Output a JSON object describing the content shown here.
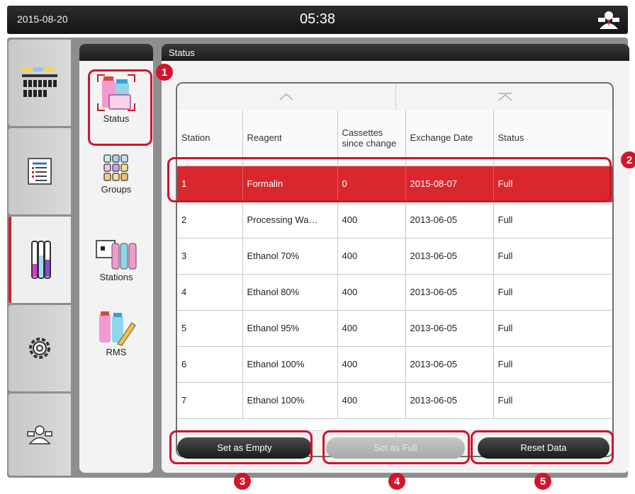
{
  "topbar": {
    "date": "2015-08-20",
    "time": "05:38"
  },
  "submenu": {
    "items": [
      {
        "label": "Status",
        "icon": "reagent-status-icon"
      },
      {
        "label": "Groups",
        "icon": "groups-icon"
      },
      {
        "label": "Stations",
        "icon": "stations-icon"
      },
      {
        "label": "RMS",
        "icon": "rms-icon"
      }
    ]
  },
  "panel": {
    "title": "Status",
    "columns": [
      "Station",
      "Reagent",
      "Cassettes since change",
      "Exchange Date",
      "Status"
    ],
    "rows": [
      [
        "1",
        "Formalin",
        "0",
        "2015-08-07",
        "Full"
      ],
      [
        "2",
        "Processing Wa…",
        "400",
        "2013-06-05",
        "Full"
      ],
      [
        "3",
        "Ethanol 70%",
        "400",
        "2013-06-05",
        "Full"
      ],
      [
        "4",
        "Ethanol 80%",
        "400",
        "2013-06-05",
        "Full"
      ],
      [
        "5",
        "Ethanol 95%",
        "400",
        "2013-06-05",
        "Full"
      ],
      [
        "6",
        "Ethanol 100%",
        "400",
        "2013-06-05",
        "Full"
      ],
      [
        "7",
        "Ethanol 100%",
        "400",
        "2013-06-05",
        "Full"
      ]
    ],
    "selected_row": 0
  },
  "buttons": {
    "set_empty": "Set as Empty",
    "set_full": "Set as Full",
    "reset": "Reset Data"
  },
  "markers": [
    "1",
    "2",
    "3",
    "4",
    "5"
  ],
  "colors": {
    "accent": "#d3142a",
    "selected_row": "#d8282d"
  }
}
